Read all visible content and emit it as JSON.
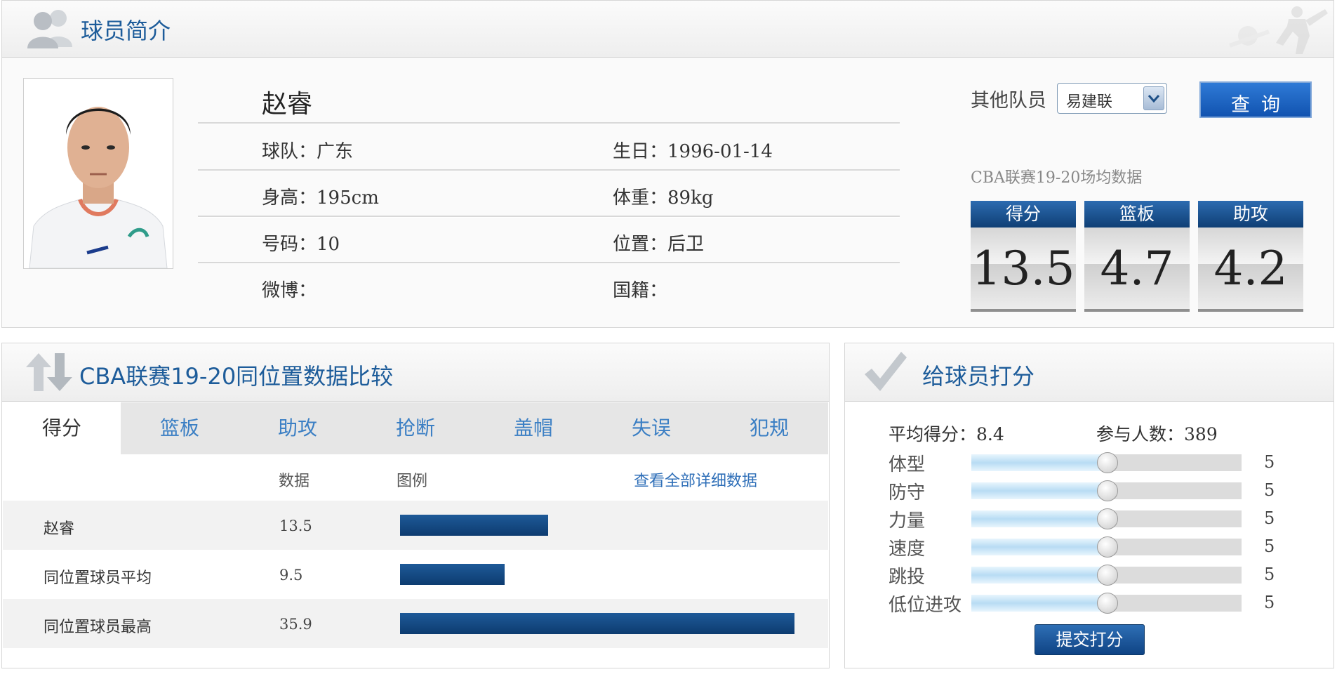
{
  "profile": {
    "title": "球员简介",
    "player_name": "赵睿",
    "team_label": "球队：",
    "team": "广东",
    "birth_label": "生日：",
    "birth": "1996-01-14",
    "height_label": "身高：",
    "height": "195cm",
    "weight_label": "体重：",
    "weight": "89kg",
    "number_label": "号码：",
    "number": "10",
    "position_label": "位置：",
    "position": "后卫",
    "weibo_label": "微博：",
    "weibo": "",
    "nationality_label": "国籍：",
    "nationality": "",
    "other_players_label": "其他队员",
    "selected_player": "易建联",
    "query_button": "查询",
    "season_note": "CBA联赛19-20场均数据",
    "stats": [
      {
        "label": "得分",
        "value": "13.5"
      },
      {
        "label": "篮板",
        "value": "4.7"
      },
      {
        "label": "助攻",
        "value": "4.2"
      }
    ]
  },
  "compare": {
    "title": "CBA联赛19-20同位置数据比较",
    "tabs": [
      "得分",
      "篮板",
      "助攻",
      "抢断",
      "盖帽",
      "失误",
      "犯规"
    ],
    "active_tab": 0,
    "col_data": "数据",
    "col_legend": "图例",
    "detail_link": "查看全部详细数据",
    "rows": [
      {
        "name": "赵睿",
        "value": "13.5",
        "num": 13.5
      },
      {
        "name": "同位置球员平均",
        "value": "9.5",
        "num": 9.5
      },
      {
        "name": "同位置球员最高",
        "value": "35.9",
        "num": 35.9
      }
    ]
  },
  "rating": {
    "title": "给球员打分",
    "avg_label": "平均得分：",
    "avg": "8.4",
    "participants_label": "参与人数：",
    "participants": "389",
    "items": [
      {
        "label": "体型",
        "value": "5",
        "fraction": 0.5
      },
      {
        "label": "防守",
        "value": "5",
        "fraction": 0.5
      },
      {
        "label": "力量",
        "value": "5",
        "fraction": 0.5
      },
      {
        "label": "速度",
        "value": "5",
        "fraction": 0.5
      },
      {
        "label": "跳投",
        "value": "5",
        "fraction": 0.5
      },
      {
        "label": "低位进攻",
        "value": "5",
        "fraction": 0.5
      }
    ],
    "submit_button": "提交打分"
  },
  "colors": {
    "title_blue": "#1d5c9a",
    "bar_blue": "#0f4384",
    "tab_link_blue": "#3b7fc4"
  }
}
